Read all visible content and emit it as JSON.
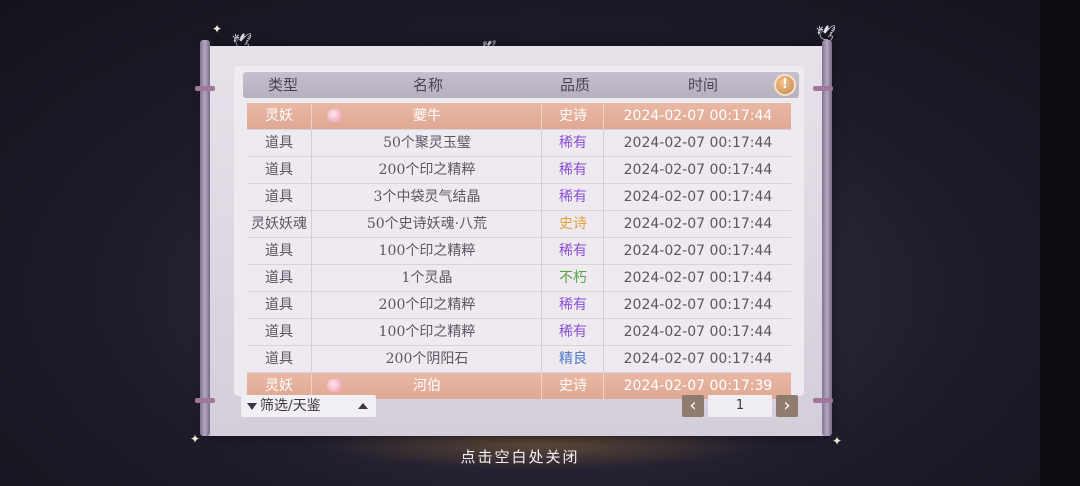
{
  "header": {
    "type": "类型",
    "name": "名称",
    "quality": "品质",
    "time": "时间",
    "info_icon": "!"
  },
  "colors": {
    "epic": "#e0a43c",
    "rare": "#8a4fd6",
    "immortal": "#5aa54c",
    "fine": "#4d78c8",
    "epic_row_bg": "#e2ab96"
  },
  "rows": [
    {
      "type": "灵妖",
      "name": "夔牛",
      "quality": "史诗",
      "time": "2024-02-07  00:17:44",
      "highlight": true,
      "badge": "pet-badge-icon"
    },
    {
      "type": "道具",
      "name": "50个聚灵玉璧",
      "quality": "稀有",
      "time": "2024-02-07  00:17:44"
    },
    {
      "type": "道具",
      "name": "200个印之精粹",
      "quality": "稀有",
      "time": "2024-02-07  00:17:44"
    },
    {
      "type": "道具",
      "name": "3个中袋灵气结晶",
      "quality": "稀有",
      "time": "2024-02-07  00:17:44"
    },
    {
      "type": "灵妖妖魂",
      "name": "50个史诗妖魂·八荒",
      "quality": "史诗",
      "time": "2024-02-07  00:17:44"
    },
    {
      "type": "道具",
      "name": "100个印之精粹",
      "quality": "稀有",
      "time": "2024-02-07  00:17:44"
    },
    {
      "type": "道具",
      "name": "1个灵晶",
      "quality": "不朽",
      "time": "2024-02-07  00:17:44"
    },
    {
      "type": "道具",
      "name": "200个印之精粹",
      "quality": "稀有",
      "time": "2024-02-07  00:17:44"
    },
    {
      "type": "道具",
      "name": "100个印之精粹",
      "quality": "稀有",
      "time": "2024-02-07  00:17:44"
    },
    {
      "type": "道具",
      "name": "200个阴阳石",
      "quality": "精良",
      "time": "2024-02-07  00:17:44"
    },
    {
      "type": "灵妖",
      "name": "河伯",
      "quality": "史诗",
      "time": "2024-02-07  00:17:39",
      "highlight": true,
      "badge": "pet-badge-icon"
    }
  ],
  "footer": {
    "filter_label": "筛选/天鉴",
    "prev": "‹",
    "next": "›",
    "page": "1"
  },
  "close_hint": "点击空白处关闭"
}
